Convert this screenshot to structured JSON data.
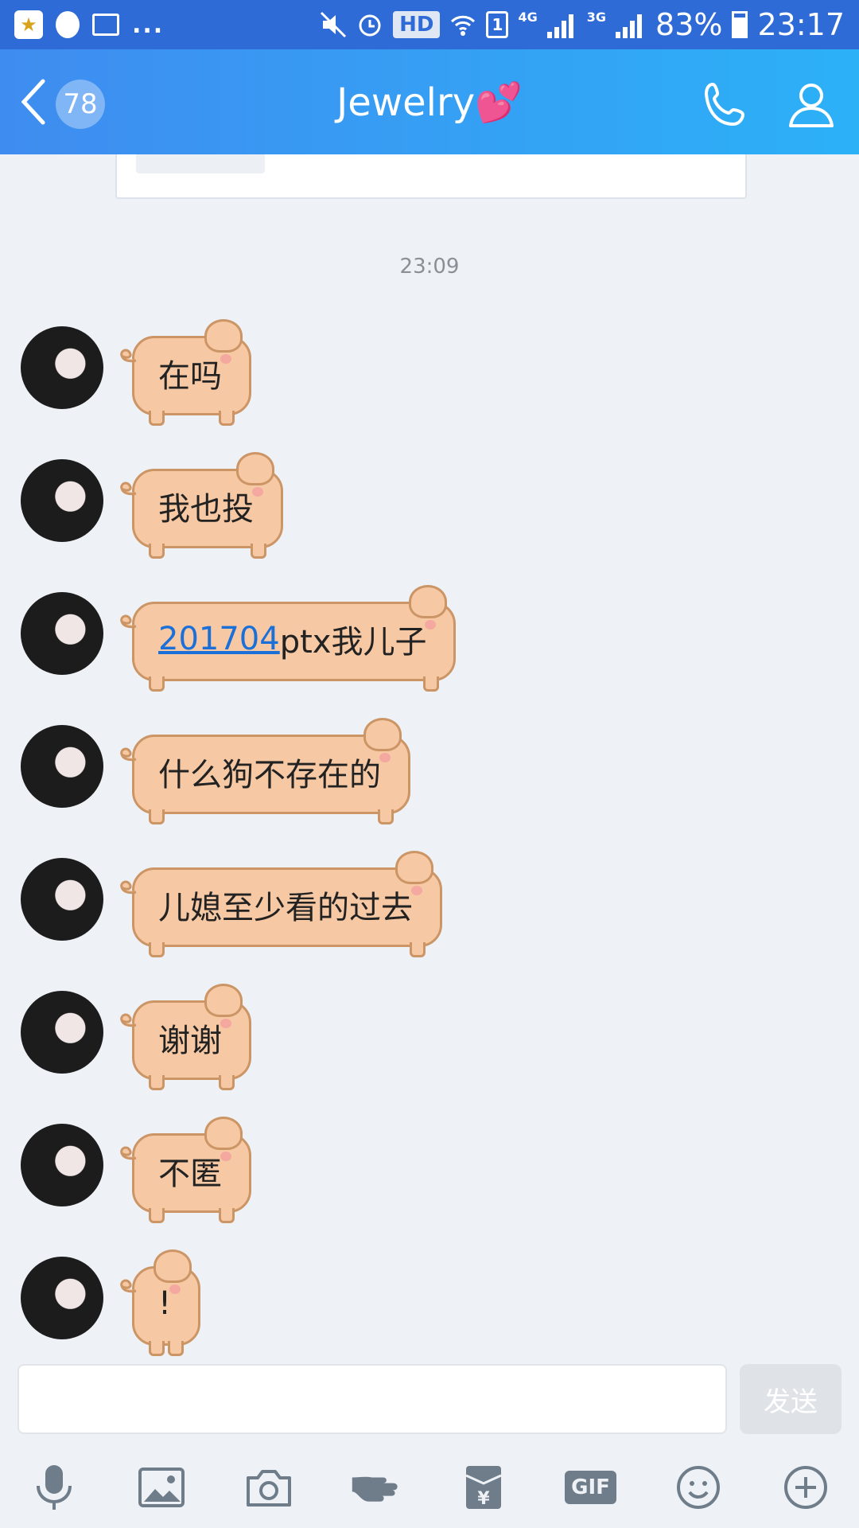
{
  "status_bar": {
    "hd_label": "HD",
    "sim_label": "1",
    "net1": "4G",
    "net2": "3G",
    "battery": "83%",
    "time": "23:17",
    "more": "..."
  },
  "header": {
    "back_badge": "78",
    "title": "Jewelry💕"
  },
  "chat": {
    "timestamp": "23:09",
    "messages": [
      {
        "text": "在吗"
      },
      {
        "text": "我也投"
      },
      {
        "link": "201704",
        "text": "ptx我儿子"
      },
      {
        "text": "什么狗不存在的"
      },
      {
        "text": "儿媳至少看的过去"
      },
      {
        "text": "谢谢"
      },
      {
        "text": "不匿"
      },
      {
        "text": "!"
      }
    ]
  },
  "input": {
    "value": "",
    "send_label": "发送"
  },
  "toolbar": {
    "gif_label": "GIF",
    "icons": [
      "microphone-icon",
      "image-icon",
      "camera-icon",
      "poke-icon",
      "red-envelope-icon",
      "gif-icon",
      "emoji-icon",
      "plus-icon"
    ]
  },
  "colors": {
    "header_start": "#3f8cf0",
    "header_end": "#2cb1f7",
    "bubble_fill": "#f6c8a3",
    "bubble_border": "#cc9566",
    "link": "#1a6fd8"
  }
}
